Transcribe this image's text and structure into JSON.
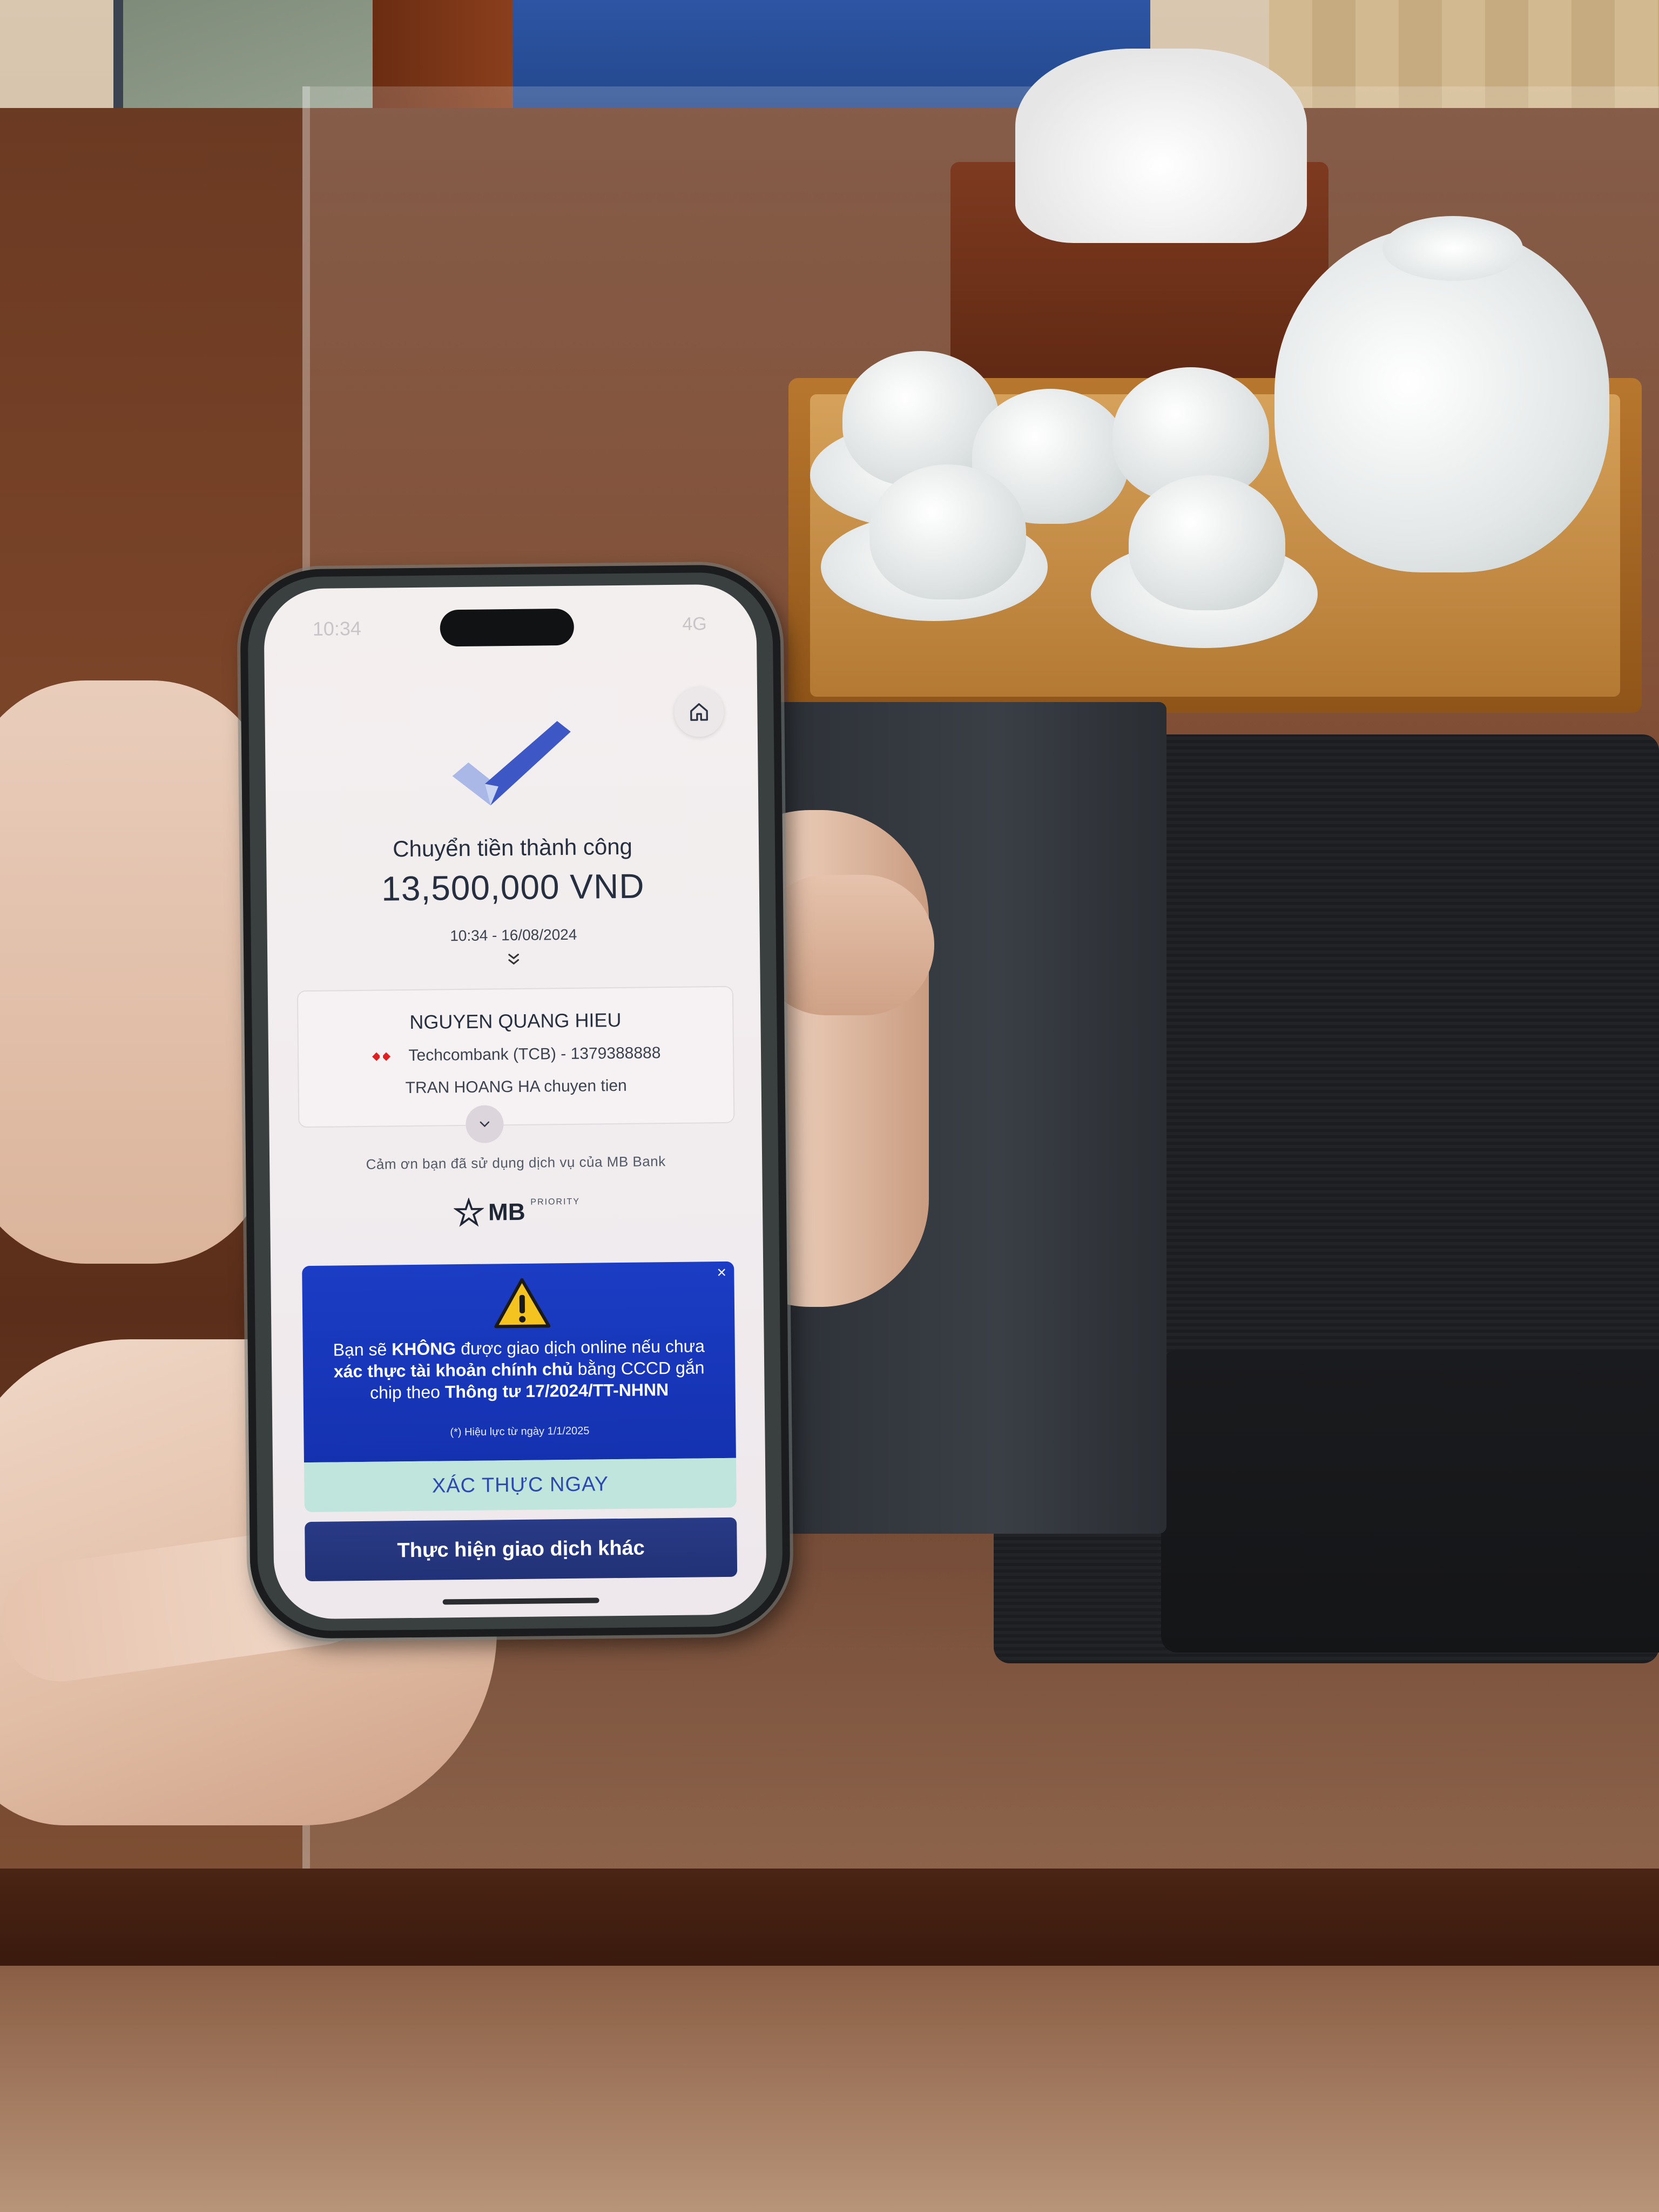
{
  "status_bar": {
    "time": "10:34",
    "right": "4G"
  },
  "receipt": {
    "title": "Chuyển tiền thành công",
    "amount": "13,500,000 VND",
    "datetime": "10:34 - 16/08/2024"
  },
  "recipient": {
    "name": "NGUYEN QUANG HIEU",
    "bank": "Techcombank (TCB) - 1379388888",
    "note": "TRAN HOANG HA chuyen tien"
  },
  "footer": {
    "thanks": "Cảm ơn bạn đã sử dụng dịch vụ của MB Bank",
    "brand": "MB",
    "brand_sub": "PRIORITY"
  },
  "banner": {
    "line1_pre": "Bạn sẽ ",
    "line1_bold": "KHÔNG",
    "line1_post": " được giao dịch online nếu chưa",
    "line2_bold": "xác thực tài khoản chính chủ",
    "line2_post": " bằng CCCD gắn",
    "line3_pre": "chip theo ",
    "line3_bold": "Thông tư 17/2024/TT-NHNN",
    "note": "(*) Hiệu lực từ ngày 1/1/2025",
    "close": "×"
  },
  "actions": {
    "verify": "XÁC THỰC NGAY",
    "other": "Thực hiện giao dịch khác"
  },
  "colors": {
    "banner_blue": "#1b3cc4",
    "verify_bg": "#bfe5dc",
    "primary_button": "#293a86",
    "techcombank_red": "#e02020"
  },
  "icons": {
    "home": "home-icon",
    "check": "check-mark-icon",
    "expand": "chevron-down-icon",
    "warning": "warning-triangle-icon",
    "bank": "techcombank-logo-icon",
    "brand": "mb-star-logo-icon"
  }
}
